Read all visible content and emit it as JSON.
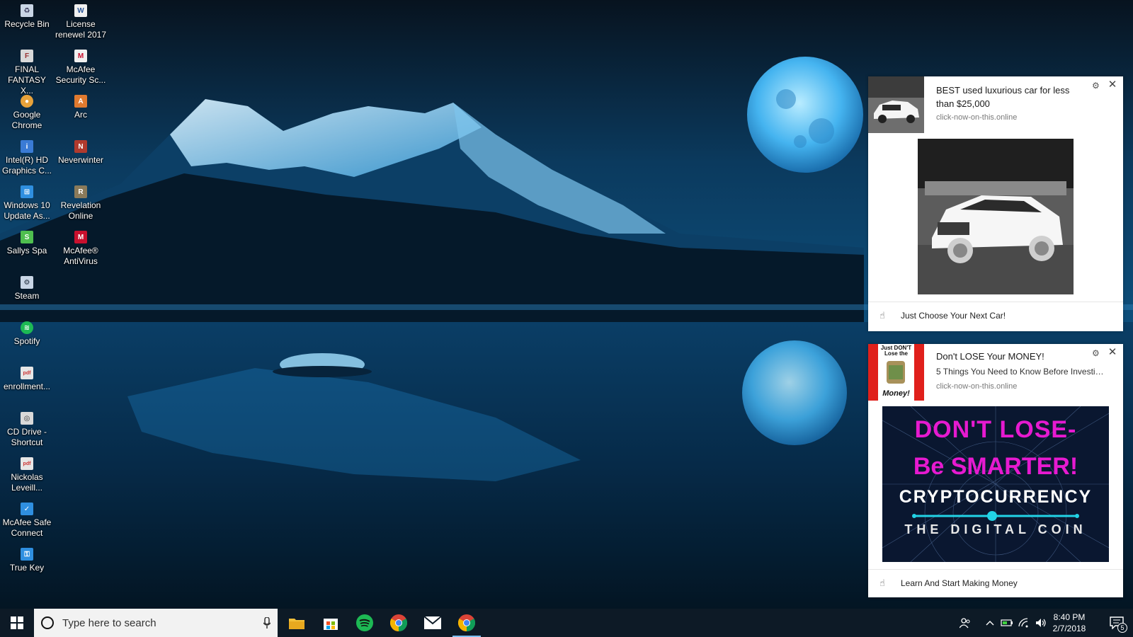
{
  "desktop": {
    "icons_col1": [
      {
        "label": "Recycle Bin",
        "icon": "recycle-bin-icon",
        "color": "#c9d6e6"
      },
      {
        "label": "FINAL FANTASY X...",
        "icon": "final-fantasy-icon",
        "color": "#d9d9d9"
      },
      {
        "label": "Google Chrome",
        "icon": "chrome-icon",
        "color": "#e8a23a"
      },
      {
        "label": "Intel(R) HD Graphics C...",
        "icon": "intel-graphics-icon",
        "color": "#3a7bd5"
      },
      {
        "label": "Windows 10 Update As...",
        "icon": "windows-update-icon",
        "color": "#2f8fe0"
      },
      {
        "label": "Sallys Spa",
        "icon": "sallys-spa-icon",
        "color": "#4fbf4f"
      },
      {
        "label": "Steam",
        "icon": "steam-icon",
        "color": "#c9d6e6"
      },
      {
        "label": "Spotify",
        "icon": "spotify-icon",
        "color": "#1db954"
      },
      {
        "label": "enrollment...",
        "icon": "pdf-file-icon",
        "color": "#e6e6e6"
      },
      {
        "label": "CD Drive - Shortcut",
        "icon": "cd-drive-icon",
        "color": "#d9d9d9"
      },
      {
        "label": "Nickolas Leveill...",
        "icon": "document-icon",
        "color": "#e6e6e6"
      },
      {
        "label": "McAfee Safe Connect",
        "icon": "mcafee-safe-connect-icon",
        "color": "#2f8fe0"
      },
      {
        "label": "True Key",
        "icon": "true-key-icon",
        "color": "#2f8fe0"
      }
    ],
    "icons_col2": [
      {
        "label": "License renewel 2017",
        "icon": "word-document-icon",
        "color": "#2b579a"
      },
      {
        "label": "McAfee Security Sc...",
        "icon": "mcafee-security-icon",
        "color": "#c8102e"
      },
      {
        "label": "Arc",
        "icon": "arc-icon",
        "color": "#e07a2f"
      },
      {
        "label": "Neverwinter",
        "icon": "neverwinter-icon",
        "color": "#b03a2e"
      },
      {
        "label": "Revelation Online",
        "icon": "revelation-online-icon",
        "color": "#8a7a5a"
      },
      {
        "label": "McAfee® AntiVirus",
        "icon": "mcafee-antivirus-icon",
        "color": "#c8102e"
      }
    ]
  },
  "notifications": [
    {
      "title": "BEST used luxurious car for less than $25,000",
      "subtitle": "",
      "source": "click-now-on-this.online",
      "action": "Just Choose Your Next Car!"
    },
    {
      "title": "Don't LOSE Your MONEY!",
      "subtitle": "5 Things You Need to Know Before Investin...",
      "source": "click-now-on-this.online",
      "thumb_text_top": "Just DON'T Lose the",
      "thumb_text_bottom": "Money!",
      "banner_line1": "DON'T LOSE-",
      "banner_line2": "Be SMARTER!",
      "banner_line3": "CRYPTOCURRENCY",
      "banner_line4": "THE DIGITAL COIN",
      "action": "Learn And Start Making Money"
    }
  ],
  "taskbar": {
    "search_placeholder": "Type here to search",
    "apps": [
      "file-explorer-icon",
      "store-icon",
      "spotify-icon",
      "chrome-icon",
      "mail-icon",
      "chrome-icon"
    ],
    "time": "8:40 PM",
    "date": "2/7/2018",
    "notification_count": "5",
    "accent": "#7cc0f2"
  }
}
